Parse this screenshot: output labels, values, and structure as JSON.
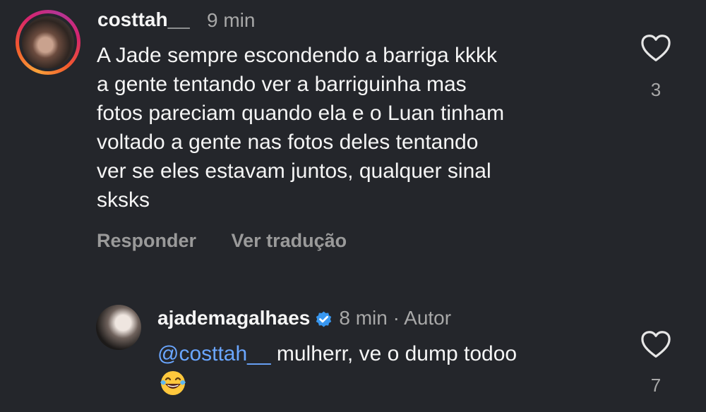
{
  "comment": {
    "username": "costtah__",
    "time": "9 min",
    "lines": [
      "A Jade sempre escondendo a barriga kkkk",
      "a gente tentando ver a barriguinha mas",
      "fotos pareciam quando ela e o Luan tinham",
      "voltado a gente nas fotos deles tentando",
      "ver se eles estavam juntos, qualquer sinal",
      "sksks"
    ],
    "reply_label": "Responder",
    "translate_label": "Ver tradução",
    "likes": "3"
  },
  "reply": {
    "username": "ajademagalhaes",
    "time": "8 min · Autor",
    "mention": "@costtah__",
    "text": " mulherr, ve o dump todoo",
    "emoji": "face-with-tears-of-joy",
    "likes": "7"
  },
  "colors": {
    "background": "#24262b",
    "mention": "#6aa6ff",
    "verified": "#3897f0"
  }
}
